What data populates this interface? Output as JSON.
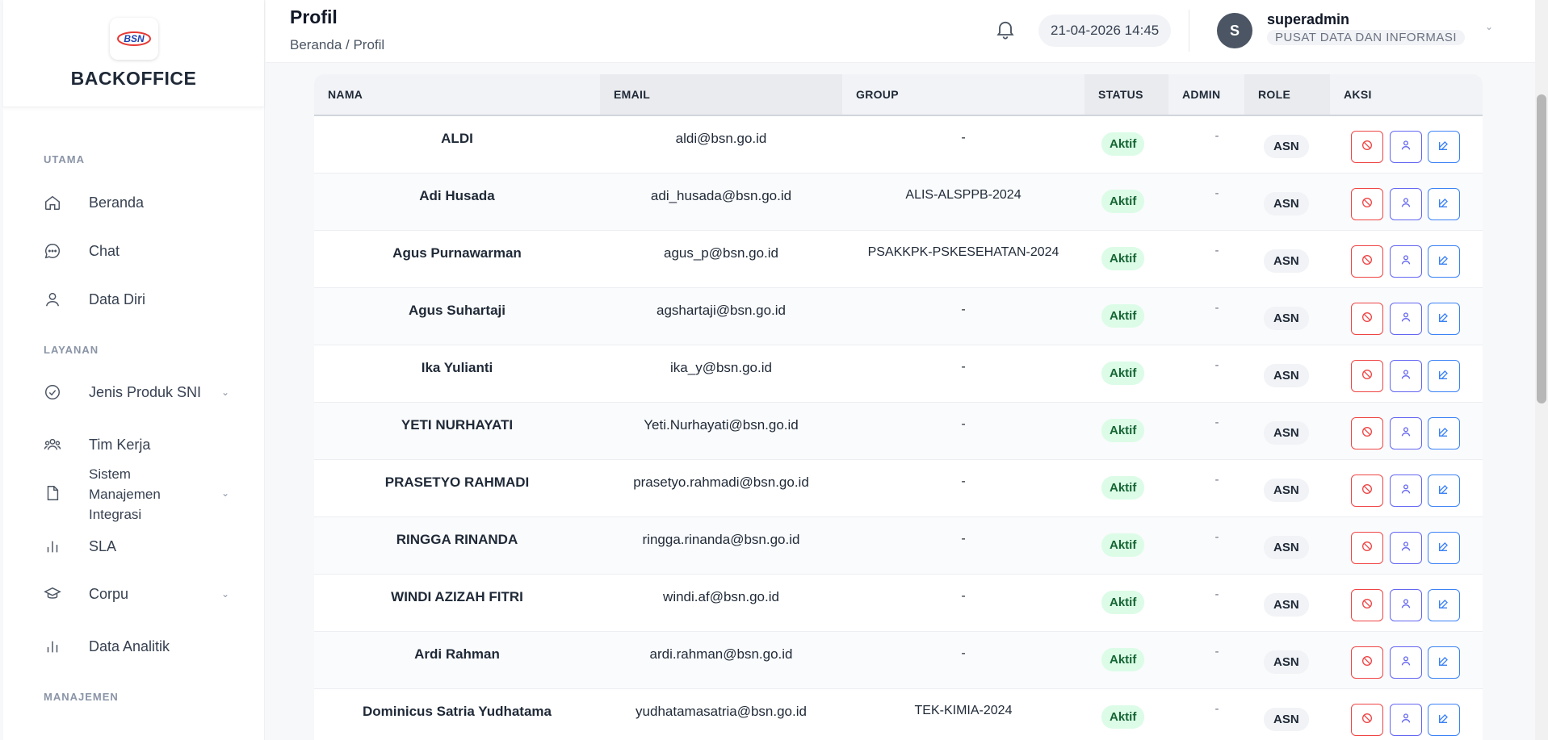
{
  "brand": {
    "logo_text": "BSN",
    "title": "BACKOFFICE"
  },
  "sidebar": {
    "sections": [
      {
        "label": "UTAMA"
      },
      {
        "label": "LAYANAN"
      },
      {
        "label": "MANAJEMEN"
      }
    ],
    "items": [
      {
        "label": "Beranda",
        "icon": "home-icon"
      },
      {
        "label": "Chat",
        "icon": "chat-icon"
      },
      {
        "label": "Data Diri",
        "icon": "user-icon"
      },
      {
        "label": "Jenis Produk SNI",
        "icon": "check-circle-icon",
        "has_caret": true
      },
      {
        "label": "Tim Kerja",
        "icon": "team-icon"
      },
      {
        "label": "Sistem\nManajemen\nIntegrasi",
        "icon": "document-icon",
        "has_caret": true
      },
      {
        "label": "SLA",
        "icon": "bar-chart-icon"
      },
      {
        "label": "Corpu",
        "icon": "graduation-cap-icon",
        "has_caret": true
      },
      {
        "label": "Data Analitik",
        "icon": "bar-chart-icon"
      }
    ]
  },
  "header": {
    "title": "Profil",
    "breadcrumb": "Beranda / Profil",
    "datetime": "21-04-2026 14:45",
    "user": {
      "initial": "S",
      "name": "superadmin",
      "org": "PUSAT DATA DAN INFORMASI"
    }
  },
  "table": {
    "columns": [
      "NAMA",
      "EMAIL",
      "GROUP",
      "STATUS",
      "ADMIN",
      "ROLE",
      "AKSI"
    ],
    "rows": [
      {
        "nama": "ALDI",
        "email": "aldi@bsn.go.id",
        "group": "-",
        "status": "Aktif",
        "admin": "-",
        "role": "ASN"
      },
      {
        "nama": "Adi Husada",
        "email": "adi_husada@bsn.go.id",
        "group": "ALIS-ALSPPB-2024",
        "status": "Aktif",
        "admin": "-",
        "role": "ASN"
      },
      {
        "nama": "Agus Purnawarman",
        "email": "agus_p@bsn.go.id",
        "group": "PSAKKPK-PSKESEHATAN-2024",
        "status": "Aktif",
        "admin": "-",
        "role": "ASN"
      },
      {
        "nama": "Agus Suhartaji",
        "email": "agshartaji@bsn.go.id",
        "group": "-",
        "status": "Aktif",
        "admin": "-",
        "role": "ASN"
      },
      {
        "nama": "Ika Yulianti",
        "email": "ika_y@bsn.go.id",
        "group": "-",
        "status": "Aktif",
        "admin": "-",
        "role": "ASN"
      },
      {
        "nama": "YETI NURHAYATI",
        "email": "Yeti.Nurhayati@bsn.go.id",
        "group": "-",
        "status": "Aktif",
        "admin": "-",
        "role": "ASN"
      },
      {
        "nama": "PRASETYO RAHMADI",
        "email": "prasetyo.rahmadi@bsn.go.id",
        "group": "-",
        "status": "Aktif",
        "admin": "-",
        "role": "ASN"
      },
      {
        "nama": "RINGGA RINANDA",
        "email": "ringga.rinanda@bsn.go.id",
        "group": "-",
        "status": "Aktif",
        "admin": "-",
        "role": "ASN"
      },
      {
        "nama": "WINDI AZIZAH FITRI",
        "email": "windi.af@bsn.go.id",
        "group": "-",
        "status": "Aktif",
        "admin": "-",
        "role": "ASN"
      },
      {
        "nama": "Ardi Rahman",
        "email": "ardi.rahman@bsn.go.id",
        "group": "-",
        "status": "Aktif",
        "admin": "-",
        "role": "ASN"
      },
      {
        "nama": "Dominicus Satria Yudhatama",
        "email": "yudhatamasatria@bsn.go.id",
        "group": "TEK-KIMIA-2024",
        "status": "Aktif",
        "admin": "-",
        "role": "ASN"
      }
    ]
  },
  "colors": {
    "active_badge_bg": "#dcfce7",
    "active_badge_text": "#166534",
    "danger": "#ef4444",
    "indigo": "#6366f1",
    "blue": "#3b82f6"
  }
}
